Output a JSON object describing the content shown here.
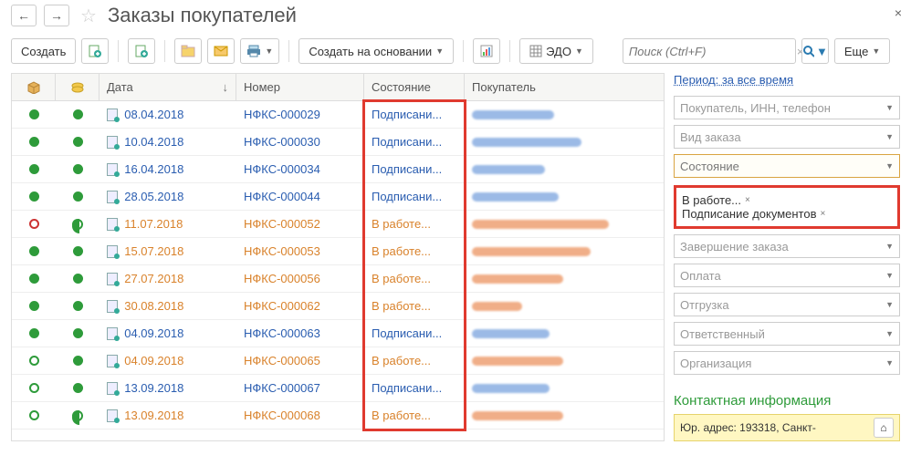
{
  "title": "Заказы покупателей",
  "toolbar": {
    "create": "Создать",
    "create_based": "Создать на основании",
    "edo": "ЭДО",
    "more": "Еще",
    "search_placeholder": "Поиск (Ctrl+F)"
  },
  "columns": {
    "date": "Дата",
    "number": "Номер",
    "state": "Состояние",
    "buyer": "Покупатель"
  },
  "rows": [
    {
      "s1": "green-fill",
      "s2": "green-fill",
      "date": "08.04.2018",
      "number": "НФКС-000029",
      "state": "Подписани...",
      "tone": "blue",
      "bw": 90
    },
    {
      "s1": "green-fill",
      "s2": "green-fill",
      "date": "10.04.2018",
      "number": "НФКС-000030",
      "state": "Подписани...",
      "tone": "blue",
      "bw": 120
    },
    {
      "s1": "green-fill",
      "s2": "green-fill",
      "date": "16.04.2018",
      "number": "НФКС-000034",
      "state": "Подписани...",
      "tone": "blue",
      "bw": 80
    },
    {
      "s1": "green-fill",
      "s2": "green-fill",
      "date": "28.05.2018",
      "number": "НФКС-000044",
      "state": "Подписани...",
      "tone": "blue",
      "bw": 95
    },
    {
      "s1": "red-ring",
      "s2": "halfmoon",
      "date": "11.07.2018",
      "number": "НФКС-000052",
      "state": "В работе...",
      "tone": "orange",
      "bw": 150
    },
    {
      "s1": "green-fill",
      "s2": "green-fill",
      "date": "15.07.2018",
      "number": "НФКС-000053",
      "state": "В работе...",
      "tone": "orange",
      "bw": 130
    },
    {
      "s1": "green-fill",
      "s2": "green-fill",
      "date": "27.07.2018",
      "number": "НФКС-000056",
      "state": "В работе...",
      "tone": "orange",
      "bw": 100
    },
    {
      "s1": "green-fill",
      "s2": "green-fill",
      "date": "30.08.2018",
      "number": "НФКС-000062",
      "state": "В работе...",
      "tone": "orange",
      "bw": 55
    },
    {
      "s1": "green-fill",
      "s2": "green-fill",
      "date": "04.09.2018",
      "number": "НФКС-000063",
      "state": "Подписани...",
      "tone": "blue",
      "bw": 85
    },
    {
      "s1": "green-ring",
      "s2": "green-fill",
      "date": "04.09.2018",
      "number": "НФКС-000065",
      "state": "В работе...",
      "tone": "orange",
      "bw": 100
    },
    {
      "s1": "green-ring",
      "s2": "green-fill",
      "date": "13.09.2018",
      "number": "НФКС-000067",
      "state": "Подписани...",
      "tone": "blue",
      "bw": 85
    },
    {
      "s1": "green-ring",
      "s2": "halfmoon",
      "date": "13.09.2018",
      "number": "НФКС-000068",
      "state": "В работе...",
      "tone": "orange",
      "bw": 100
    }
  ],
  "filters": {
    "period": "Период: за все время",
    "buyer_ph": "Покупатель, ИНН, телефон",
    "order_type_ph": "Вид заказа",
    "state_ph": "Состояние",
    "tags": [
      "В работе...",
      "Подписание документов"
    ],
    "finish_ph": "Завершение заказа",
    "payment_ph": "Оплата",
    "shipment_ph": "Отгрузка",
    "responsible_ph": "Ответственный",
    "org_ph": "Организация"
  },
  "contact": {
    "title": "Контактная информация",
    "addr": "Юр. адрес: 193318, Санкт-"
  }
}
